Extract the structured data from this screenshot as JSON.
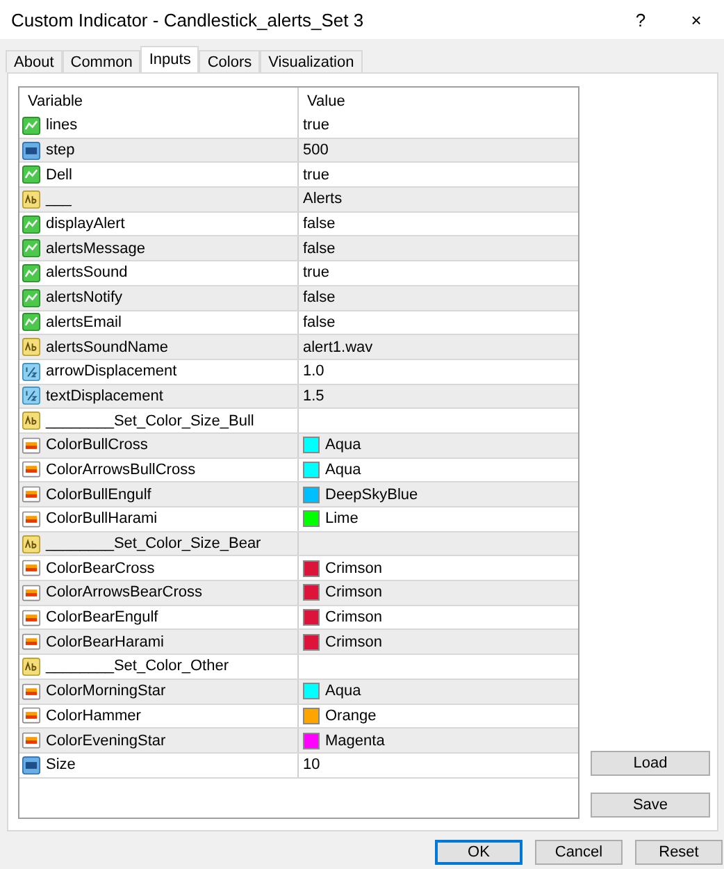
{
  "window": {
    "title": "Custom Indicator - Candlestick_alerts_Set 3",
    "help": "?",
    "close": "×"
  },
  "tabs": [
    {
      "label": "About",
      "selected": false
    },
    {
      "label": "Common",
      "selected": false
    },
    {
      "label": "Inputs",
      "selected": true
    },
    {
      "label": "Colors",
      "selected": false
    },
    {
      "label": "Visualization",
      "selected": false
    }
  ],
  "table": {
    "columns": [
      "Variable",
      "Value"
    ],
    "rows": [
      {
        "kind": "bool",
        "variable": "lines",
        "value": "true"
      },
      {
        "kind": "int",
        "variable": "step",
        "value": "500"
      },
      {
        "kind": "bool",
        "variable": "Dell",
        "value": "true"
      },
      {
        "kind": "string",
        "variable": "___",
        "value": "Alerts"
      },
      {
        "kind": "bool",
        "variable": "displayAlert",
        "value": "false"
      },
      {
        "kind": "bool",
        "variable": "alertsMessage",
        "value": "false"
      },
      {
        "kind": "bool",
        "variable": "alertsSound",
        "value": "true"
      },
      {
        "kind": "bool",
        "variable": "alertsNotify",
        "value": "false"
      },
      {
        "kind": "bool",
        "variable": "alertsEmail",
        "value": "false"
      },
      {
        "kind": "string",
        "variable": "alertsSoundName",
        "value": "alert1.wav"
      },
      {
        "kind": "double",
        "variable": "arrowDisplacement",
        "value": "1.0"
      },
      {
        "kind": "double",
        "variable": "textDisplacement",
        "value": "1.5"
      },
      {
        "kind": "string",
        "variable": "________Set_Color_Size_Bull"
      },
      {
        "kind": "color",
        "variable": "ColorBullCross",
        "value": "Aqua",
        "color": "#00ffff"
      },
      {
        "kind": "color",
        "variable": "ColorArrowsBullCross",
        "value": "Aqua",
        "color": "#00ffff"
      },
      {
        "kind": "color",
        "variable": "ColorBullEngulf",
        "value": "DeepSkyBlue",
        "color": "#00bfff"
      },
      {
        "kind": "color",
        "variable": "ColorBullHarami",
        "value": "Lime",
        "color": "#00ff00"
      },
      {
        "kind": "string",
        "variable": "________Set_Color_Size_Bear"
      },
      {
        "kind": "color",
        "variable": "ColorBearCross",
        "value": "Crimson",
        "color": "#dc143c"
      },
      {
        "kind": "color",
        "variable": "ColorArrowsBearCross",
        "value": "Crimson",
        "color": "#dc143c"
      },
      {
        "kind": "color",
        "variable": "ColorBearEngulf",
        "value": "Crimson",
        "color": "#dc143c"
      },
      {
        "kind": "color",
        "variable": "ColorBearHarami",
        "value": "Crimson",
        "color": "#dc143c"
      },
      {
        "kind": "string",
        "variable": "________Set_Color_Other"
      },
      {
        "kind": "color",
        "variable": "ColorMorningStar",
        "value": "Aqua",
        "color": "#00ffff"
      },
      {
        "kind": "color",
        "variable": "ColorHammer",
        "value": "Orange",
        "color": "#ffa500"
      },
      {
        "kind": "color",
        "variable": "ColorEveningStar",
        "value": "Magenta",
        "color": "#ff00ff"
      },
      {
        "kind": "int",
        "variable": "Size",
        "value": "10"
      }
    ]
  },
  "side_buttons": [
    "Load",
    "Save"
  ],
  "buttons": [
    {
      "label": "OK",
      "default": true
    },
    {
      "label": "Cancel",
      "default": false
    },
    {
      "label": "Reset",
      "default": false
    }
  ]
}
